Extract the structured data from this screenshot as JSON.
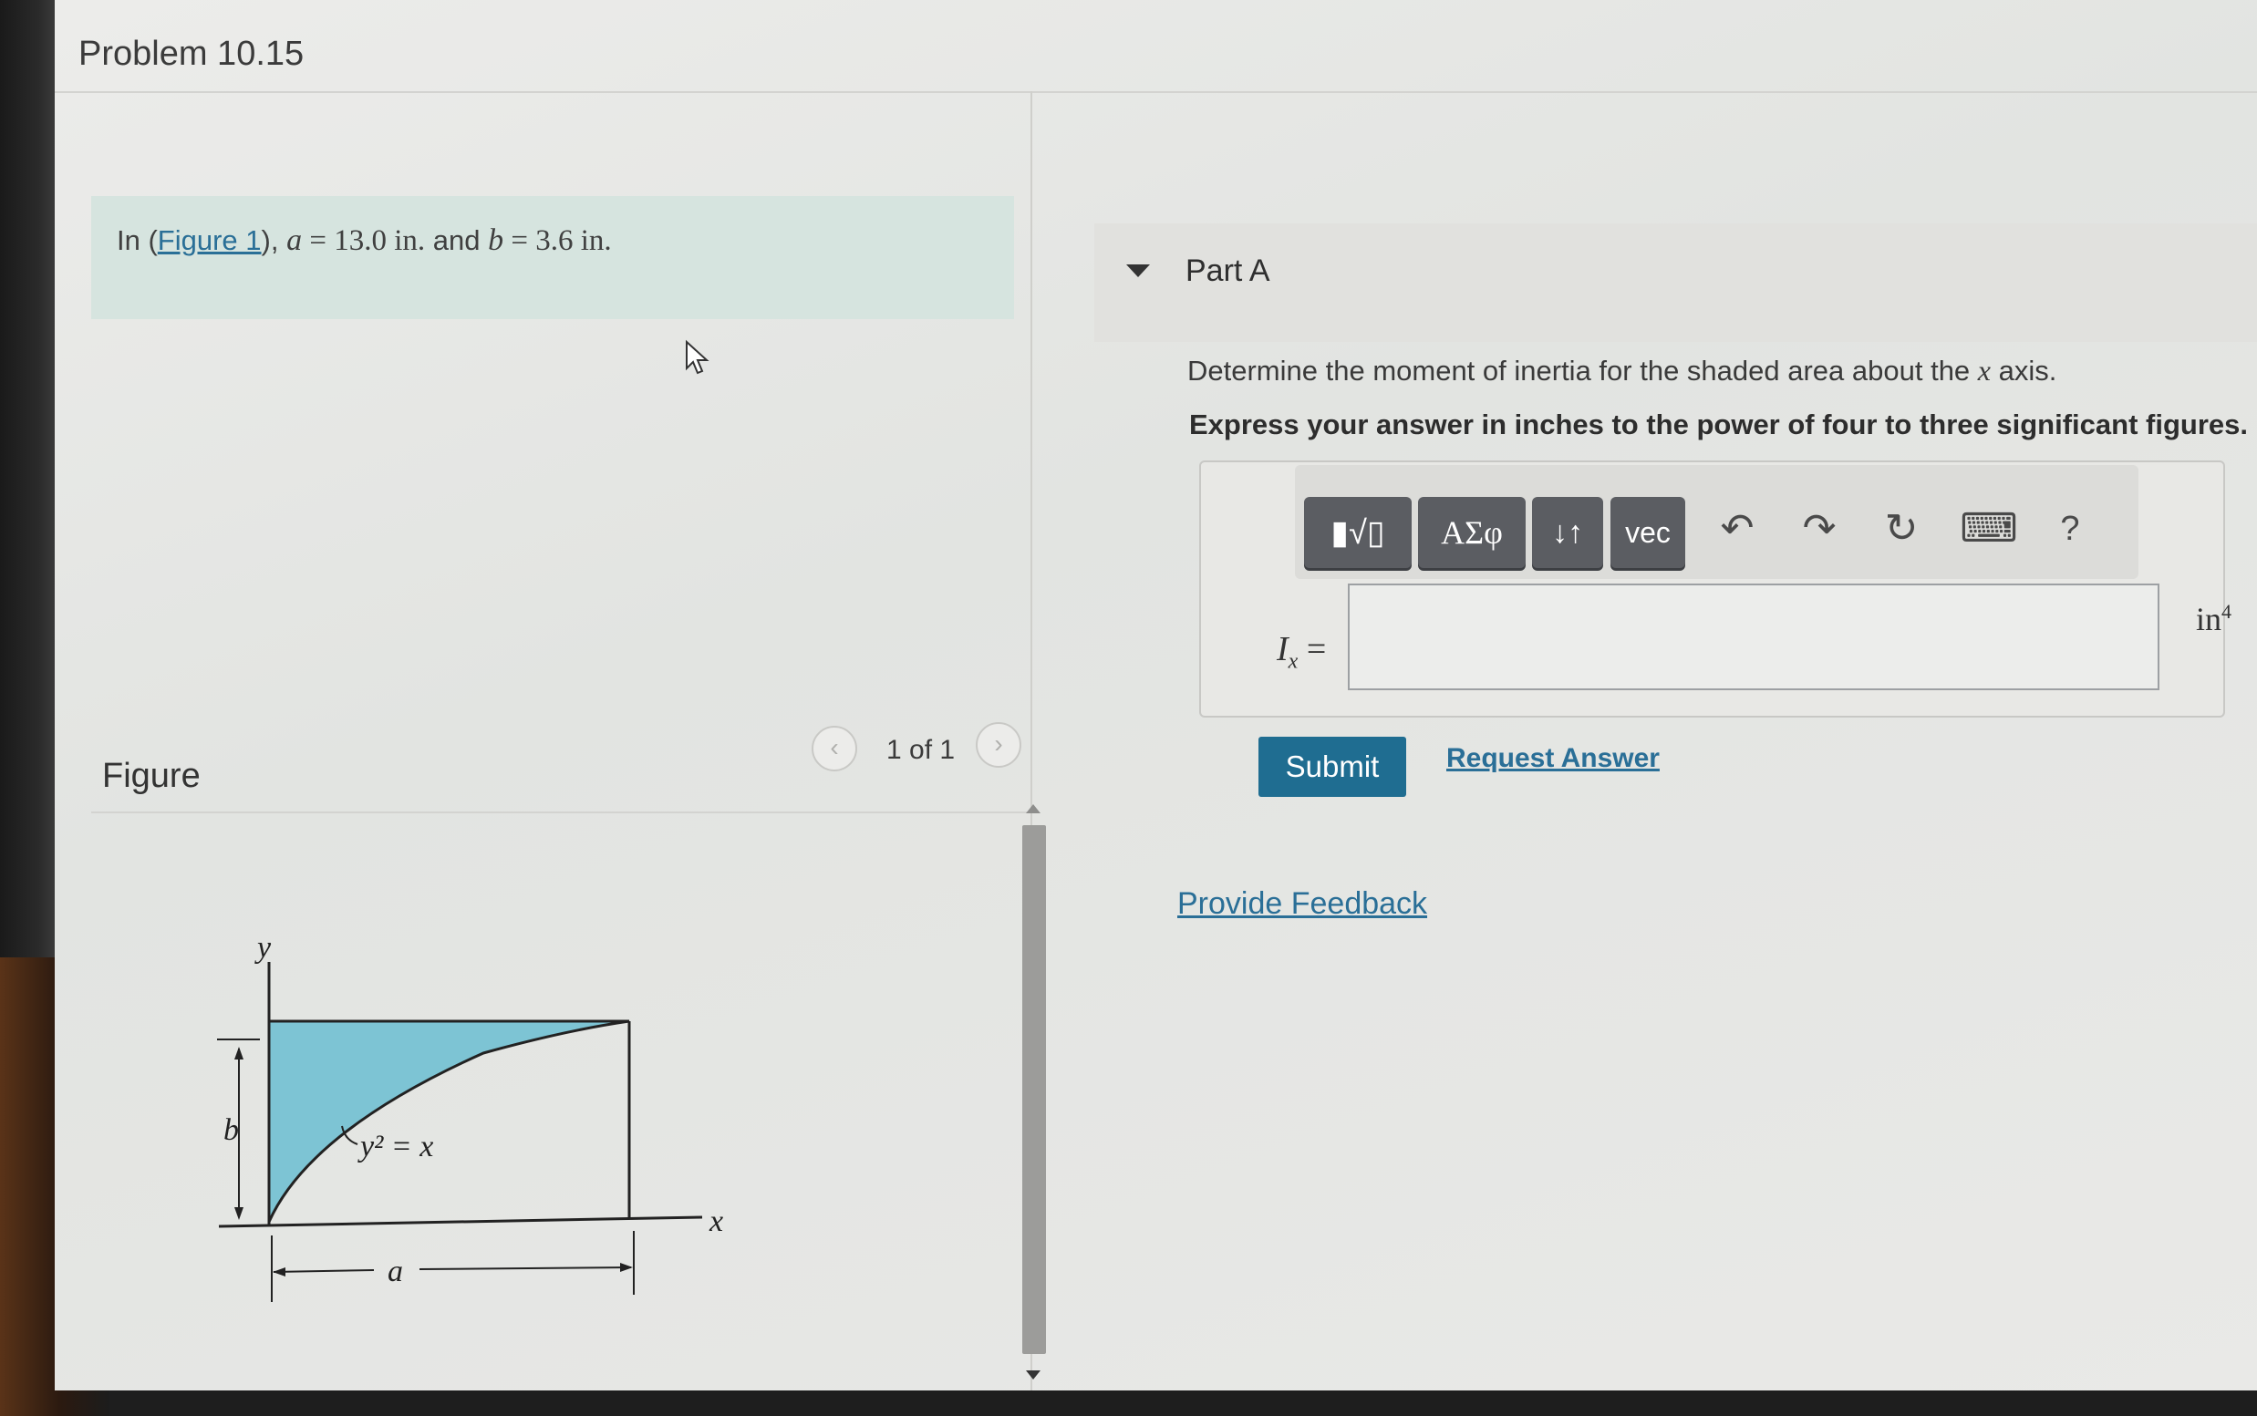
{
  "problem": {
    "title": "Problem 10.15"
  },
  "statement": {
    "prefix": "In (",
    "figure_link": "Figure 1",
    "middle": "), ",
    "a_var": "a",
    "a_value": " = 13.0 in.",
    "and_text": " and ",
    "b_var": "b",
    "b_value": " = 3.6 in."
  },
  "figure_panel": {
    "label": "Figure",
    "prev_icon": "chevron-left-icon",
    "next_icon": "chevron-right-icon",
    "prev_glyph": "‹",
    "next_glyph": "›",
    "page_count": "1 of 1"
  },
  "figure": {
    "y_axis_label": "y",
    "x_axis_label": "x",
    "b_label": "b",
    "a_label": "a",
    "curve_label": "y² = x",
    "fill_color": "#7dc4d4"
  },
  "part": {
    "title": "Part A",
    "question_pre": "Determine the moment of inertia for the shaded area about the ",
    "question_var": "x",
    "question_post": " axis.",
    "instruction": "Express your answer in inches to the power of four to three significant figures."
  },
  "toolbar": {
    "templates_label": "▮√▯",
    "greek_label": "ΑΣφ",
    "arrows_label": "↓↑",
    "vec_label": "vec",
    "undo_glyph": "↶",
    "redo_glyph": "↷",
    "reset_glyph": "↻",
    "keyboard_glyph": "⌨",
    "help_glyph": "?"
  },
  "answer": {
    "var_main": "I",
    "var_sub": "x",
    "equals": " =",
    "value": "",
    "unit_main": "in",
    "unit_exp": "4"
  },
  "actions": {
    "submit": "Submit",
    "request_answer": "Request Answer",
    "provide_feedback": "Provide Feedback"
  },
  "colors": {
    "accent": "#1f6d91",
    "link": "#2a6f97",
    "statement_bg": "#d6e4df"
  }
}
